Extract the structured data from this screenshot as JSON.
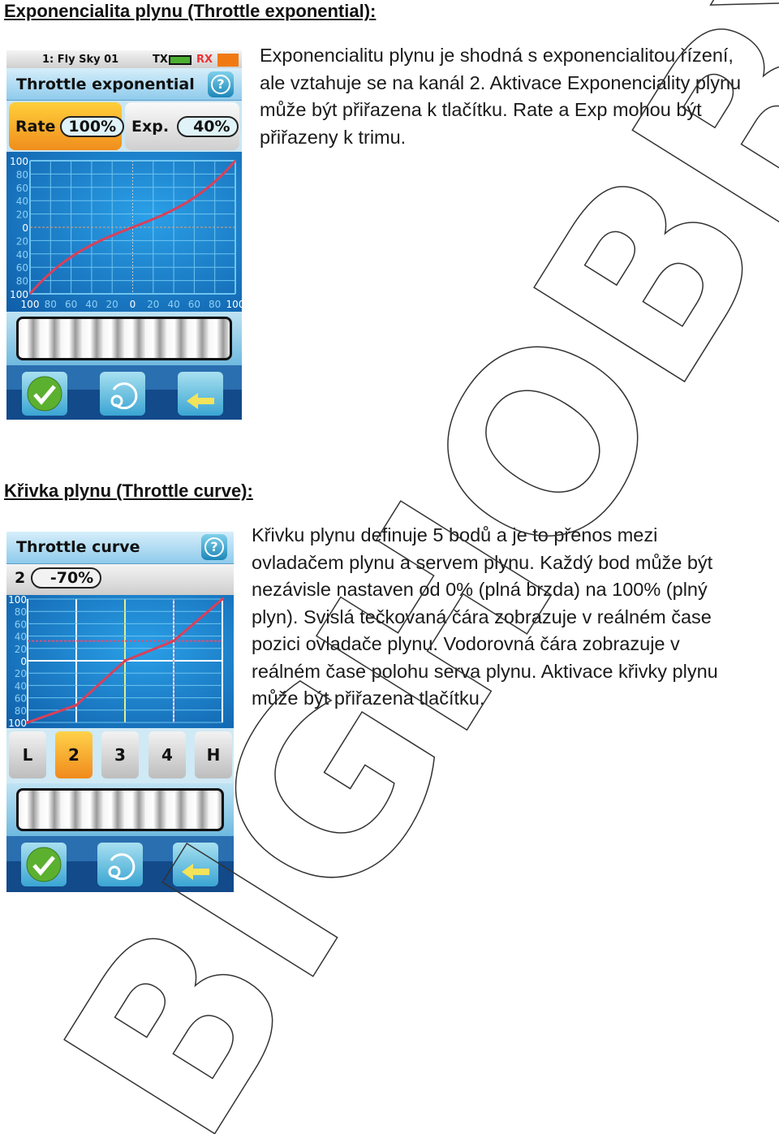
{
  "section1": {
    "heading": "Exponencialita plynu (Throttle exponential):",
    "lines": [
      "Exponencialitu plynu je shodná s exponencialitou řízení,",
      "ale vztahuje se na kanál 2. Aktivace Exponenciality plynu",
      "může být přiřazena k tlačítku. Rate a Exp mohou být",
      "přiřazeny k trimu."
    ],
    "screen": {
      "model": "1: Fly Sky 01",
      "tx": "TX",
      "rx": "RX",
      "title": "Throttle exponential",
      "rate_label": "Rate",
      "rate_value": "100%",
      "exp_label": "Exp.",
      "exp_value": "40%",
      "y_ticks": [
        "100",
        "80",
        "60",
        "40",
        "20",
        "0",
        "20",
        "40",
        "60",
        "80",
        "100"
      ],
      "x_ticks": [
        "100",
        "80",
        "60",
        "40",
        "20",
        "0",
        "20",
        "40",
        "60",
        "80",
        "100"
      ],
      "icons": [
        "help-icon",
        "check-icon",
        "reset-icon",
        "back-icon"
      ]
    }
  },
  "section2": {
    "heading": "Křivka plynu (Throttle curve):",
    "lines": [
      "Křivku plynu definuje 5 bodů a je to přenos mezi",
      "ovladačem plynu a servem plynu. Každý bod může být",
      "nezávisle nastaven od 0% (plná brzda) na 100% (plný",
      "plyn). Svislá tečkovaná čára zobrazuje v reálném čase",
      "pozici ovladače plynu. Vodorovná čára zobrazuje v",
      "reálném čase polohu serva plynu. Aktivace křivky plynu",
      "může být přiřazena tlačítku."
    ],
    "screen": {
      "title": "Throttle curve",
      "point_index": "2",
      "point_value": "-70%",
      "y_ticks": [
        "100",
        "80",
        "60",
        "40",
        "20",
        "0",
        "20",
        "40",
        "60",
        "80",
        "100"
      ],
      "points": [
        "L",
        "2",
        "3",
        "4",
        "H"
      ],
      "selected_point": "2"
    }
  },
  "chart_data": [
    {
      "type": "line",
      "title": "Throttle exponential",
      "xlim": [
        -100,
        100
      ],
      "ylim": [
        -100,
        100
      ],
      "grid": true,
      "rate": 100,
      "exp": 40,
      "crosshair": {
        "x": 0,
        "y": 0
      },
      "color": "#d9405a"
    },
    {
      "type": "line",
      "title": "Throttle curve",
      "x": [
        "L",
        "2",
        "3",
        "4",
        "H"
      ],
      "values": [
        -100,
        -72,
        0,
        32,
        100
      ],
      "ylim": [
        -100,
        100
      ],
      "grid": true,
      "crosshair": {
        "x": "4",
        "y": 32
      },
      "color": "#d9405a"
    }
  ],
  "watermark": "BIGHOBBY",
  "colors": {
    "accent_orange": "#f39a1e",
    "screen_blue": "#1a6fb8",
    "curve": "#d9405a"
  }
}
